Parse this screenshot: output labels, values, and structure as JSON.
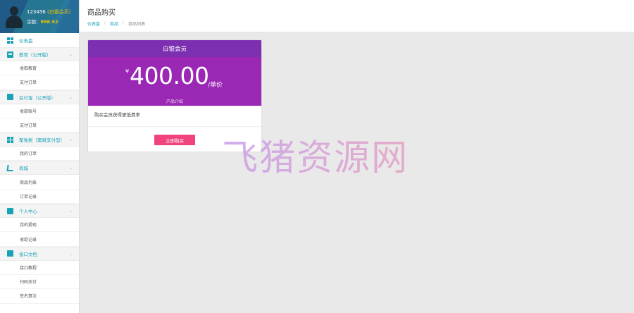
{
  "profile": {
    "username": "123456",
    "user_tag": "(白银会员)",
    "balance_label": "余额：",
    "balance_value": "998.52"
  },
  "sidebar": {
    "home": "仪表盘",
    "sections": [
      {
        "label": "教育（公开版）",
        "icon": "book-icon",
        "items": [
          "收取教育",
          "支付订单"
        ]
      },
      {
        "label": "在付宝（公开版）",
        "icon": "card-icon",
        "items": [
          "收款账号",
          "支付订单"
        ]
      },
      {
        "label": "聚免税（聚跳支付型）",
        "icon": "grid-icon",
        "items": [
          "我的订单"
        ]
      },
      {
        "label": "商城",
        "icon": "cart-icon",
        "items": [
          "商品列表",
          "订单记录"
        ]
      },
      {
        "label": "个人中心",
        "icon": "user-icon",
        "items": [
          "我的提现",
          "收款记录"
        ]
      },
      {
        "label": "接口文档",
        "icon": "doc-icon",
        "items": [
          "接口教程",
          "扫码支付",
          "签名算法"
        ]
      }
    ]
  },
  "header": {
    "title": "商品购买",
    "breadcrumb": [
      "仪表盘",
      "商品",
      "商品列表"
    ]
  },
  "product": {
    "name": "白银会员",
    "currency": "¥",
    "price": "400.00",
    "unit": "/单价",
    "intro": "产品介绍",
    "description": "购买会员获得更低费率",
    "buy_label": "立即购买"
  },
  "watermark": "飞猪资源网",
  "colors": {
    "accent": "#1aa3b7",
    "card_header": "#7c2fb0",
    "card_body": "#9a28b4",
    "buy_button": "#f0437e",
    "profile_bg": "#1f5b86"
  }
}
